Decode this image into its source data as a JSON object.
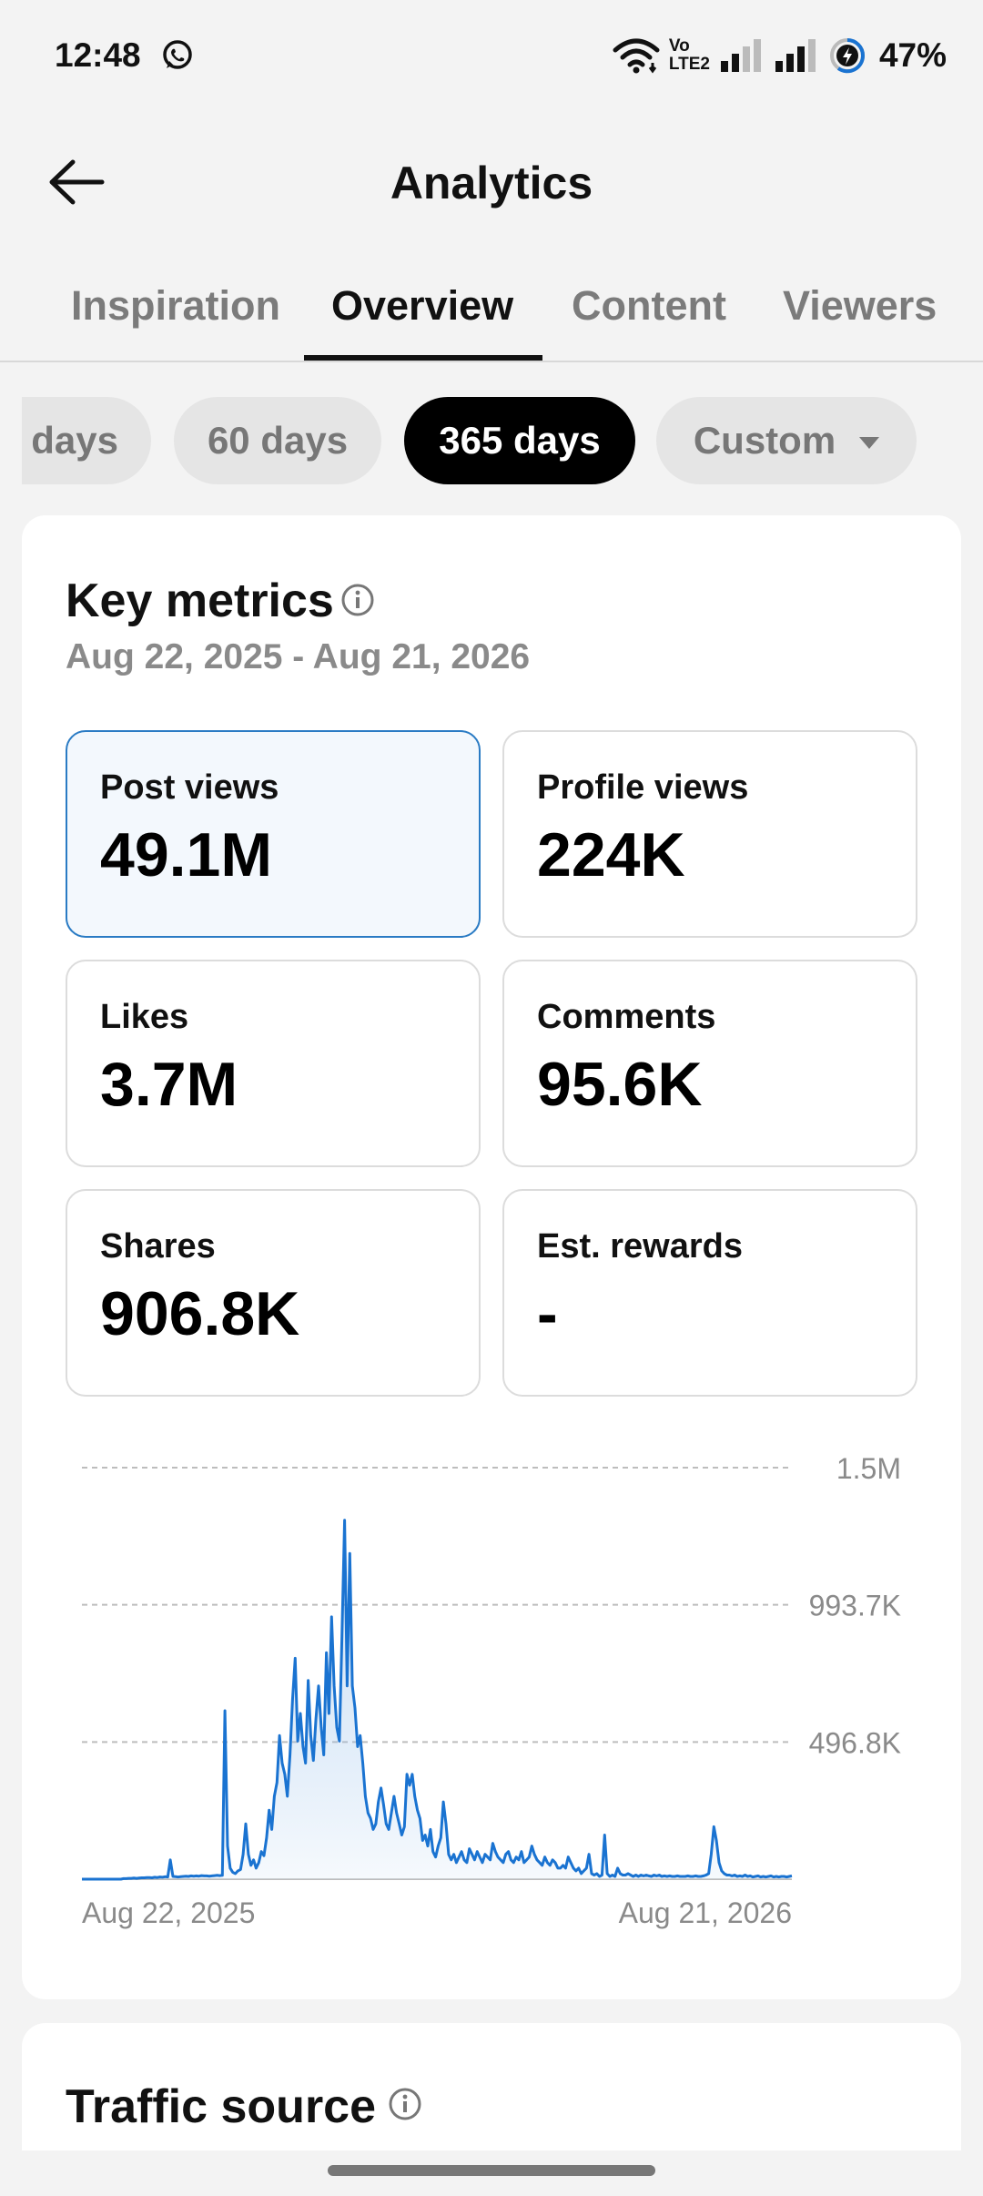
{
  "status_bar": {
    "time": "12:48",
    "app_icon": "whatsapp-icon",
    "icons": [
      "wifi-icon",
      "volte-icon",
      "signal-icon",
      "signal-icon",
      "battery-saver-icon"
    ],
    "network_label_top": "Vo",
    "network_label_bottom": "LTE2",
    "battery": "47%"
  },
  "header": {
    "title": "Analytics",
    "back_icon": "arrow-left-icon"
  },
  "tabs": [
    {
      "label": "Inspiration",
      "active": false
    },
    {
      "label": "Overview",
      "active": true
    },
    {
      "label": "Content",
      "active": false
    },
    {
      "label": "Viewers",
      "active": false
    }
  ],
  "date_chips": [
    {
      "label": "days",
      "selected": false
    },
    {
      "label": "60 days",
      "selected": false
    },
    {
      "label": "365 days",
      "selected": true
    },
    {
      "label": "Custom",
      "selected": false,
      "icon": "caret-down-icon"
    }
  ],
  "key_metrics": {
    "title": "Key metrics",
    "info_icon": "info-icon",
    "date_range": "Aug 22, 2025 - Aug 21, 2026",
    "metrics": [
      {
        "label": "Post views",
        "value": "49.1M",
        "selected": true
      },
      {
        "label": "Profile views",
        "value": "224K",
        "selected": false
      },
      {
        "label": "Likes",
        "value": "3.7M",
        "selected": false
      },
      {
        "label": "Comments",
        "value": "95.6K",
        "selected": false
      },
      {
        "label": "Shares",
        "value": "906.8K",
        "selected": false
      },
      {
        "label": "Est. rewards",
        "value": "-",
        "selected": false
      }
    ]
  },
  "chart_data": {
    "type": "area",
    "title": "",
    "xlabel": "",
    "ylabel": "",
    "x_tick_labels": [
      "Aug 22, 2025",
      "Aug 21, 2026"
    ],
    "y_tick_labels": [
      "496.8K",
      "993.7K",
      "1.5M"
    ],
    "y_ticks": [
      496800,
      993700,
      1490500
    ],
    "ylim": [
      0,
      1490500
    ],
    "grid": true,
    "line_color": "#1a73d1",
    "fill_color": "#e6f0fa",
    "series": [
      {
        "values": [
          0,
          0,
          0,
          0,
          0,
          0,
          0,
          0,
          0,
          0,
          0,
          0,
          0,
          0,
          0,
          0,
          2000,
          2000,
          3000,
          3000,
          4000,
          3000,
          4000,
          5000,
          5000,
          6000,
          6000,
          5000,
          7000,
          6000,
          8000,
          7000,
          9000,
          8000,
          70000,
          10000,
          9000,
          8000,
          9000,
          10000,
          11000,
          10000,
          12000,
          11000,
          12000,
          11000,
          13000,
          12000,
          12000,
          11000,
          12000,
          13000,
          14000,
          13000,
          14000,
          610000,
          120000,
          40000,
          25000,
          20000,
          30000,
          35000,
          90000,
          200000,
          90000,
          50000,
          70000,
          40000,
          60000,
          100000,
          85000,
          150000,
          250000,
          180000,
          300000,
          350000,
          520000,
          420000,
          380000,
          300000,
          450000,
          650000,
          800000,
          500000,
          600000,
          480000,
          420000,
          720000,
          520000,
          430000,
          580000,
          700000,
          550000,
          450000,
          820000,
          600000,
          950000,
          700000,
          550000,
          500000,
          880000,
          1300000,
          700000,
          1180000,
          700000,
          620000,
          480000,
          520000,
          420000,
          300000,
          240000,
          220000,
          180000,
          200000,
          280000,
          330000,
          270000,
          200000,
          180000,
          240000,
          300000,
          240000,
          200000,
          160000,
          190000,
          380000,
          340000,
          380000,
          300000,
          250000,
          220000,
          140000,
          160000,
          120000,
          180000,
          100000,
          80000,
          120000,
          150000,
          280000,
          200000,
          90000,
          70000,
          90000,
          60000,
          80000,
          100000,
          70000,
          60000,
          110000,
          90000,
          70000,
          100000,
          80000,
          60000,
          90000,
          80000,
          70000,
          130000,
          100000,
          80000,
          70000,
          60000,
          90000,
          100000,
          70000,
          60000,
          80000,
          70000,
          100000,
          60000,
          70000,
          80000,
          120000,
          90000,
          70000,
          60000,
          50000,
          80000,
          60000,
          50000,
          70000,
          60000,
          40000,
          40000,
          50000,
          40000,
          80000,
          60000,
          40000,
          30000,
          40000,
          20000,
          30000,
          40000,
          90000,
          20000,
          15000,
          20000,
          10000,
          15000,
          160000,
          20000,
          10000,
          15000,
          10000,
          40000,
          20000,
          15000,
          15000,
          20000,
          15000,
          10000,
          15000,
          10000,
          15000,
          12000,
          15000,
          12000,
          10000,
          15000,
          12000,
          15000,
          10000,
          12000,
          10000,
          12000,
          10000,
          10000,
          12000,
          10000,
          10000,
          10000,
          12000,
          10000,
          10000,
          12000,
          10000,
          10000,
          12000,
          15000,
          20000,
          90000,
          190000,
          140000,
          60000,
          30000,
          20000,
          15000,
          15000,
          12000,
          15000,
          10000,
          12000,
          10000,
          15000,
          10000,
          12000,
          8000,
          10000,
          12000,
          8000,
          10000,
          8000,
          10000,
          12000,
          8000,
          10000,
          8000,
          10000,
          10000,
          8000,
          10000,
          12000
        ]
      }
    ]
  },
  "traffic_source": {
    "title": "Traffic source",
    "info_icon": "info-icon"
  }
}
